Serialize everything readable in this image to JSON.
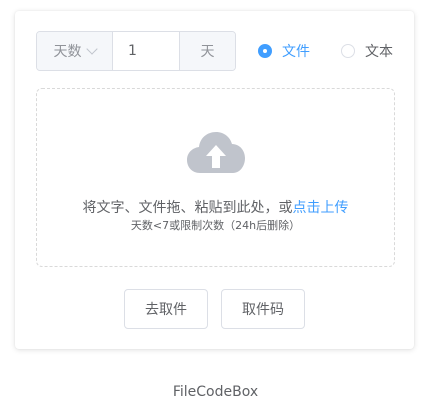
{
  "form": {
    "unit_select": "天数",
    "value": "1",
    "suffix": "天"
  },
  "radios": [
    {
      "label": "文件",
      "checked": true
    },
    {
      "label": "文本",
      "checked": false
    }
  ],
  "upload": {
    "text": "将文字、文件拖、粘贴到此处，或",
    "link": "点击上传",
    "hint": "天数<7或限制次数（24h后删除）"
  },
  "buttons": {
    "fetch": "去取件",
    "code": "取件码"
  },
  "footer": "FileCodeBox",
  "colors": {
    "accent": "#409eff",
    "cloud": "#c0c4cc"
  }
}
